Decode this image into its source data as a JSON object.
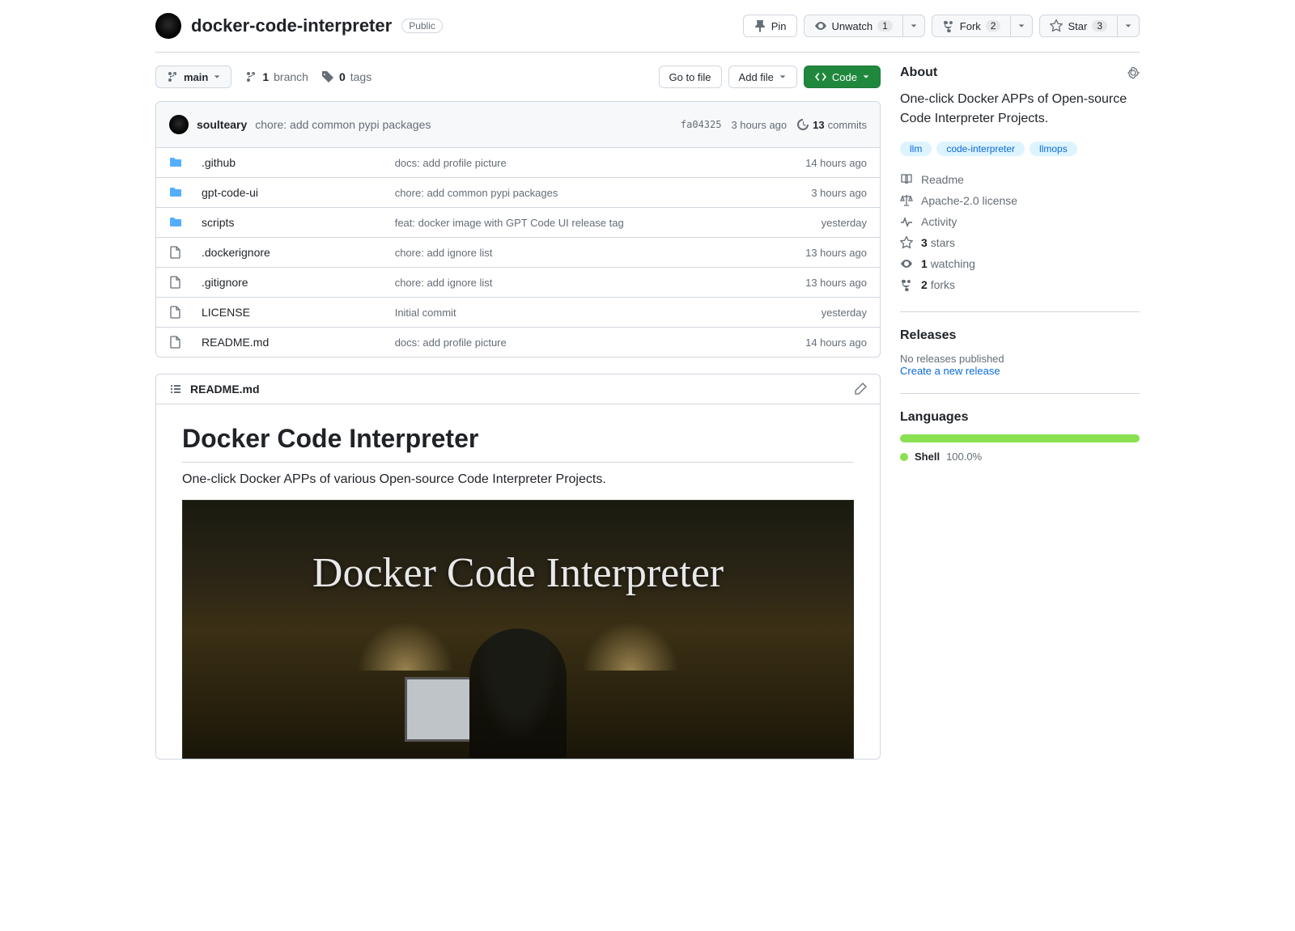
{
  "header": {
    "repo_name": "docker-code-interpreter",
    "visibility": "Public",
    "pin": "Pin",
    "unwatch": {
      "label": "Unwatch",
      "count": "1"
    },
    "fork": {
      "label": "Fork",
      "count": "2"
    },
    "star": {
      "label": "Star",
      "count": "3"
    }
  },
  "file_nav": {
    "branch": "main",
    "branch_count": "1",
    "branch_label": "branch",
    "tag_count": "0",
    "tag_label": "tags",
    "go_to_file": "Go to file",
    "add_file": "Add file",
    "code": "Code"
  },
  "latest_commit": {
    "author": "soulteary",
    "message": "chore: add common pypi packages",
    "hash": "fa04325",
    "age": "3 hours ago",
    "total_count": "13",
    "total_label": "commits"
  },
  "files": [
    {
      "type": "dir",
      "name": ".github",
      "msg": "docs: add profile picture",
      "age": "14 hours ago"
    },
    {
      "type": "dir",
      "name": "gpt-code-ui",
      "msg": "chore: add common pypi packages",
      "age": "3 hours ago"
    },
    {
      "type": "dir",
      "name": "scripts",
      "msg": "feat: docker image with GPT Code UI release tag",
      "age": "yesterday"
    },
    {
      "type": "file",
      "name": ".dockerignore",
      "msg": "chore: add ignore list",
      "age": "13 hours ago"
    },
    {
      "type": "file",
      "name": ".gitignore",
      "msg": "chore: add ignore list",
      "age": "13 hours ago"
    },
    {
      "type": "file",
      "name": "LICENSE",
      "msg": "Initial commit",
      "age": "yesterday"
    },
    {
      "type": "file",
      "name": "README.md",
      "msg": "docs: add profile picture",
      "age": "14 hours ago"
    }
  ],
  "readme": {
    "filename": "README.md",
    "h1": "Docker Code Interpreter",
    "intro": "One-click Docker APPs of various Open-source Code Interpreter Projects.",
    "hero_text": "Docker Code Interpreter"
  },
  "sidebar": {
    "about_title": "About",
    "description": "One-click Docker APPs of Open-source Code Interpreter Projects.",
    "topics": [
      "llm",
      "code-interpreter",
      "llmops"
    ],
    "links": {
      "readme": "Readme",
      "license": "Apache-2.0 license",
      "activity": "Activity",
      "stars": {
        "n": "3",
        "label": "stars"
      },
      "watching": {
        "n": "1",
        "label": "watching"
      },
      "forks": {
        "n": "2",
        "label": "forks"
      }
    },
    "releases": {
      "title": "Releases",
      "none": "No releases published",
      "create": "Create a new release"
    },
    "languages": {
      "title": "Languages",
      "items": [
        {
          "name": "Shell",
          "pct": "100.0%",
          "color": "#89e051"
        }
      ]
    }
  }
}
